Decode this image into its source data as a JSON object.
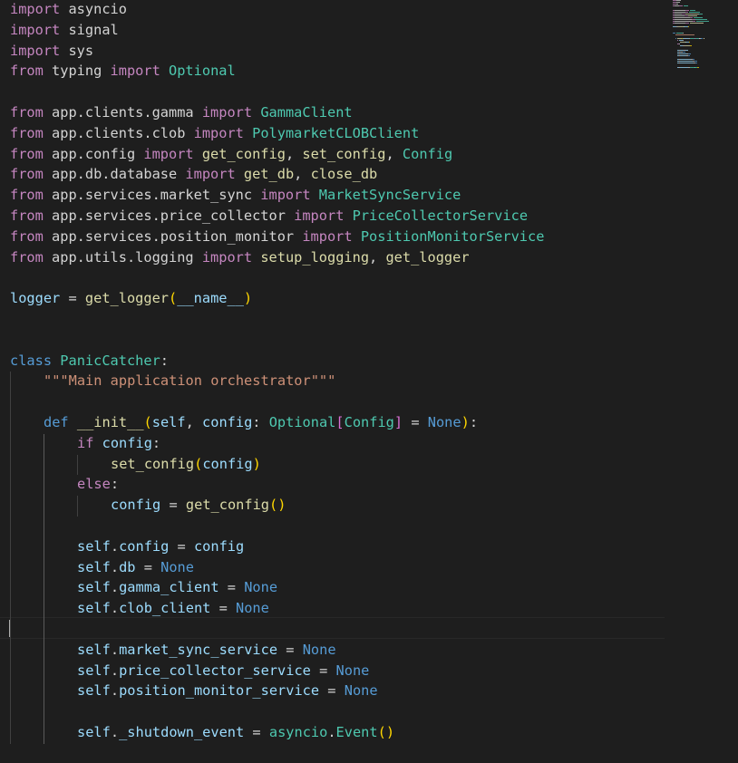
{
  "editor": {
    "language": "python",
    "theme": "dark",
    "cursor_line": 30,
    "lines": [
      {
        "indent": 0,
        "tokens": [
          [
            "kw",
            "import"
          ],
          [
            "p",
            " asyncio"
          ]
        ]
      },
      {
        "indent": 0,
        "tokens": [
          [
            "kw",
            "import"
          ],
          [
            "p",
            " signal"
          ]
        ]
      },
      {
        "indent": 0,
        "tokens": [
          [
            "kw",
            "import"
          ],
          [
            "p",
            " sys"
          ]
        ]
      },
      {
        "indent": 0,
        "tokens": [
          [
            "kw",
            "from"
          ],
          [
            "p",
            " typing "
          ],
          [
            "kw",
            "import"
          ],
          [
            "p",
            " "
          ],
          [
            "cls",
            "Optional"
          ]
        ]
      },
      {
        "indent": 0,
        "tokens": []
      },
      {
        "indent": 0,
        "tokens": [
          [
            "kw",
            "from"
          ],
          [
            "p",
            " app.clients.gamma "
          ],
          [
            "kw",
            "import"
          ],
          [
            "p",
            " "
          ],
          [
            "cls",
            "GammaClient"
          ]
        ]
      },
      {
        "indent": 0,
        "tokens": [
          [
            "kw",
            "from"
          ],
          [
            "p",
            " app.clients.clob "
          ],
          [
            "kw",
            "import"
          ],
          [
            "p",
            " "
          ],
          [
            "cls",
            "PolymarketCLOBClient"
          ]
        ]
      },
      {
        "indent": 0,
        "tokens": [
          [
            "kw",
            "from"
          ],
          [
            "p",
            " app.config "
          ],
          [
            "kw",
            "import"
          ],
          [
            "p",
            " "
          ],
          [
            "fn",
            "get_config"
          ],
          [
            "p",
            ", "
          ],
          [
            "fn",
            "set_config"
          ],
          [
            "p",
            ", "
          ],
          [
            "cls",
            "Config"
          ]
        ]
      },
      {
        "indent": 0,
        "tokens": [
          [
            "kw",
            "from"
          ],
          [
            "p",
            " app.db.database "
          ],
          [
            "kw",
            "import"
          ],
          [
            "p",
            " "
          ],
          [
            "fn",
            "get_db"
          ],
          [
            "p",
            ", "
          ],
          [
            "fn",
            "close_db"
          ]
        ]
      },
      {
        "indent": 0,
        "tokens": [
          [
            "kw",
            "from"
          ],
          [
            "p",
            " app.services.market_sync "
          ],
          [
            "kw",
            "import"
          ],
          [
            "p",
            " "
          ],
          [
            "cls",
            "MarketSyncService"
          ]
        ]
      },
      {
        "indent": 0,
        "tokens": [
          [
            "kw",
            "from"
          ],
          [
            "p",
            " app.services.price_collector "
          ],
          [
            "kw",
            "import"
          ],
          [
            "p",
            " "
          ],
          [
            "cls",
            "PriceCollectorService"
          ]
        ]
      },
      {
        "indent": 0,
        "tokens": [
          [
            "kw",
            "from"
          ],
          [
            "p",
            " app.services.position_monitor "
          ],
          [
            "kw",
            "import"
          ],
          [
            "p",
            " "
          ],
          [
            "cls",
            "PositionMonitorService"
          ]
        ]
      },
      {
        "indent": 0,
        "tokens": [
          [
            "kw",
            "from"
          ],
          [
            "p",
            " app.utils.logging "
          ],
          [
            "kw",
            "import"
          ],
          [
            "p",
            " "
          ],
          [
            "fn",
            "setup_logging"
          ],
          [
            "p",
            ", "
          ],
          [
            "fn",
            "get_logger"
          ]
        ]
      },
      {
        "indent": 0,
        "tokens": []
      },
      {
        "indent": 0,
        "tokens": [
          [
            "v",
            "logger"
          ],
          [
            "p",
            " = "
          ],
          [
            "fn",
            "get_logger"
          ],
          [
            "b1",
            "("
          ],
          [
            "v",
            "__name__"
          ],
          [
            "b1",
            ")"
          ]
        ]
      },
      {
        "indent": 0,
        "tokens": []
      },
      {
        "indent": 0,
        "tokens": []
      },
      {
        "indent": 0,
        "tokens": [
          [
            "dk",
            "class"
          ],
          [
            "p",
            " "
          ],
          [
            "cls",
            "PanicCatcher"
          ],
          [
            "p",
            ":"
          ]
        ]
      },
      {
        "indent": 1,
        "tokens": [
          [
            "str",
            "\"\"\"Main application orchestrator\"\"\""
          ]
        ]
      },
      {
        "indent": 0,
        "tokens": []
      },
      {
        "indent": 1,
        "tokens": [
          [
            "dk",
            "def"
          ],
          [
            "p",
            " "
          ],
          [
            "fn",
            "__init__"
          ],
          [
            "b1",
            "("
          ],
          [
            "v",
            "self"
          ],
          [
            "p",
            ", "
          ],
          [
            "v",
            "config"
          ],
          [
            "p",
            ": "
          ],
          [
            "cls",
            "Optional"
          ],
          [
            "b2",
            "["
          ],
          [
            "cls",
            "Config"
          ],
          [
            "b2",
            "]"
          ],
          [
            "p",
            " = "
          ],
          [
            "dk",
            "None"
          ],
          [
            "b1",
            ")"
          ],
          [
            "p",
            ":"
          ]
        ]
      },
      {
        "indent": 2,
        "tokens": [
          [
            "kw",
            "if"
          ],
          [
            "p",
            " "
          ],
          [
            "v",
            "config"
          ],
          [
            "p",
            ":"
          ]
        ]
      },
      {
        "indent": 3,
        "tokens": [
          [
            "fn",
            "set_config"
          ],
          [
            "b1",
            "("
          ],
          [
            "v",
            "config"
          ],
          [
            "b1",
            ")"
          ]
        ]
      },
      {
        "indent": 2,
        "tokens": [
          [
            "kw",
            "else"
          ],
          [
            "p",
            ":"
          ]
        ]
      },
      {
        "indent": 3,
        "tokens": [
          [
            "v",
            "config"
          ],
          [
            "p",
            " = "
          ],
          [
            "fn",
            "get_config"
          ],
          [
            "b1",
            "()"
          ]
        ]
      },
      {
        "indent": 0,
        "tokens": []
      },
      {
        "indent": 2,
        "tokens": [
          [
            "v",
            "self"
          ],
          [
            "p",
            "."
          ],
          [
            "v",
            "config"
          ],
          [
            "p",
            " = "
          ],
          [
            "v",
            "config"
          ]
        ]
      },
      {
        "indent": 2,
        "tokens": [
          [
            "v",
            "self"
          ],
          [
            "p",
            "."
          ],
          [
            "v",
            "db"
          ],
          [
            "p",
            " = "
          ],
          [
            "dk",
            "None"
          ]
        ]
      },
      {
        "indent": 2,
        "tokens": [
          [
            "v",
            "self"
          ],
          [
            "p",
            "."
          ],
          [
            "v",
            "gamma_client"
          ],
          [
            "p",
            " = "
          ],
          [
            "dk",
            "None"
          ]
        ]
      },
      {
        "indent": 2,
        "tokens": [
          [
            "v",
            "self"
          ],
          [
            "p",
            "."
          ],
          [
            "v",
            "clob_client"
          ],
          [
            "p",
            " = "
          ],
          [
            "dk",
            "None"
          ]
        ]
      },
      {
        "indent": 0,
        "tokens": []
      },
      {
        "indent": 2,
        "tokens": [
          [
            "v",
            "self"
          ],
          [
            "p",
            "."
          ],
          [
            "v",
            "market_sync_service"
          ],
          [
            "p",
            " = "
          ],
          [
            "dk",
            "None"
          ]
        ]
      },
      {
        "indent": 2,
        "tokens": [
          [
            "v",
            "self"
          ],
          [
            "p",
            "."
          ],
          [
            "v",
            "price_collector_service"
          ],
          [
            "p",
            " = "
          ],
          [
            "dk",
            "None"
          ]
        ]
      },
      {
        "indent": 2,
        "tokens": [
          [
            "v",
            "self"
          ],
          [
            "p",
            "."
          ],
          [
            "v",
            "position_monitor_service"
          ],
          [
            "p",
            " = "
          ],
          [
            "dk",
            "None"
          ]
        ]
      },
      {
        "indent": 0,
        "tokens": []
      },
      {
        "indent": 2,
        "tokens": [
          [
            "v",
            "self"
          ],
          [
            "p",
            "."
          ],
          [
            "v",
            "_shutdown_event"
          ],
          [
            "p",
            " = "
          ],
          [
            "cls",
            "asyncio"
          ],
          [
            "p",
            "."
          ],
          [
            "cls",
            "Event"
          ],
          [
            "b1",
            "()"
          ]
        ]
      },
      {
        "indent": 0,
        "tokens": []
      }
    ]
  },
  "colors": {
    "background": "#1e1e1e",
    "p": "#d4d4d4",
    "kw": "#c586c0",
    "dk": "#569cd6",
    "cls": "#4ec9b0",
    "fn": "#dcdcaa",
    "v": "#9cdcfe",
    "str": "#ce9178",
    "b1": "#ffd700",
    "b2": "#da70d6"
  }
}
